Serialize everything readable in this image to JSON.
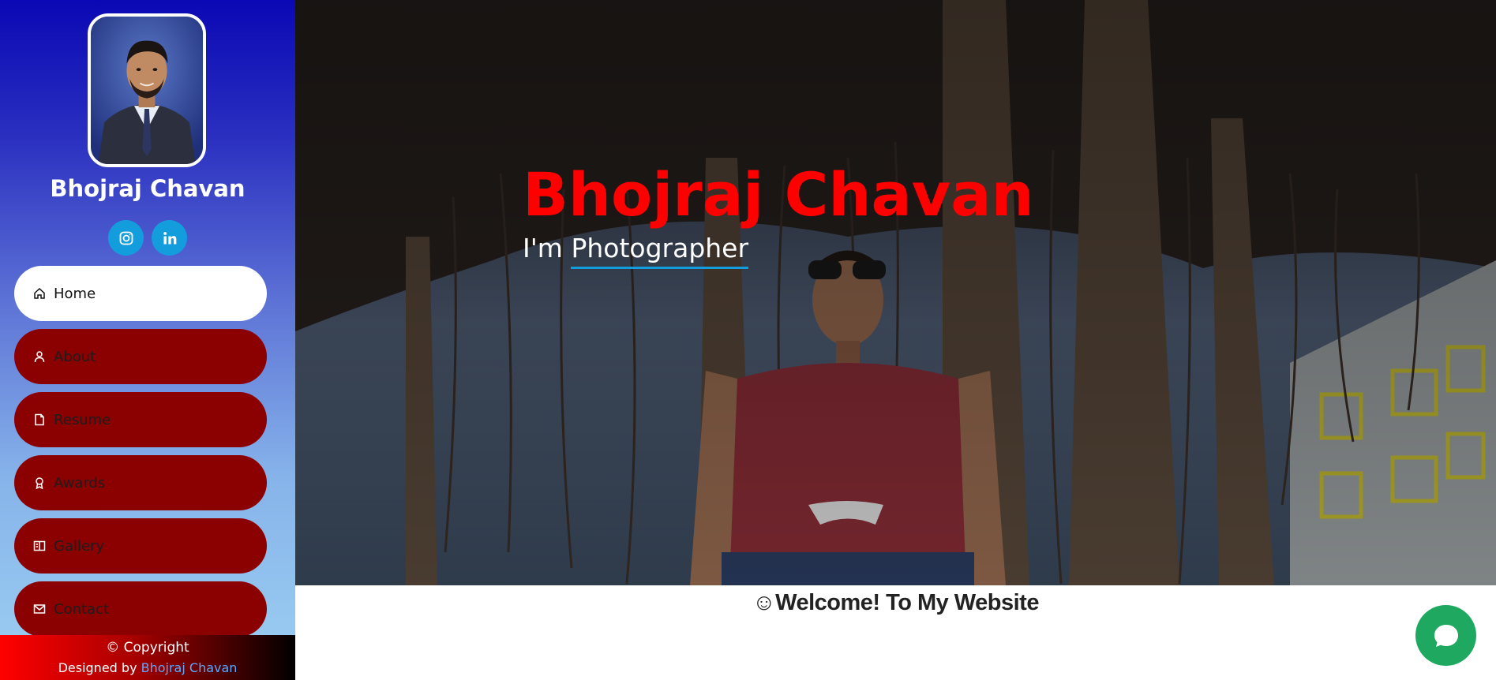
{
  "profile": {
    "name": "Bhojraj Chavan"
  },
  "social": [
    {
      "icon": "instagram-icon"
    },
    {
      "icon": "linkedin-icon"
    }
  ],
  "nav": {
    "items": [
      {
        "label": "Home",
        "icon": "home-icon",
        "active": true
      },
      {
        "label": "About",
        "icon": "person-icon",
        "active": false
      },
      {
        "label": "Resume",
        "icon": "file-icon",
        "active": false
      },
      {
        "label": "Awards",
        "icon": "award-icon",
        "active": false
      },
      {
        "label": "Gallery",
        "icon": "book-icon",
        "active": false
      },
      {
        "label": "Contact",
        "icon": "envelope-icon",
        "active": false
      }
    ]
  },
  "footer": {
    "copyright": "© Copyright",
    "designed_by": "Designed by",
    "designer": "Bhojraj Chavan"
  },
  "hero": {
    "title": "Bhojraj Chavan",
    "subtitle_prefix": "I'm ",
    "subtitle_typed": "Photographer"
  },
  "welcome": {
    "text": "☺Welcome! To My Website"
  },
  "chat": {
    "icon": "chat-bubble-icon"
  },
  "colors": {
    "accent": "#149ddd",
    "nav_bg": "#8b0000",
    "title_red": "#ff0000",
    "chat_green": "#1ea860"
  }
}
